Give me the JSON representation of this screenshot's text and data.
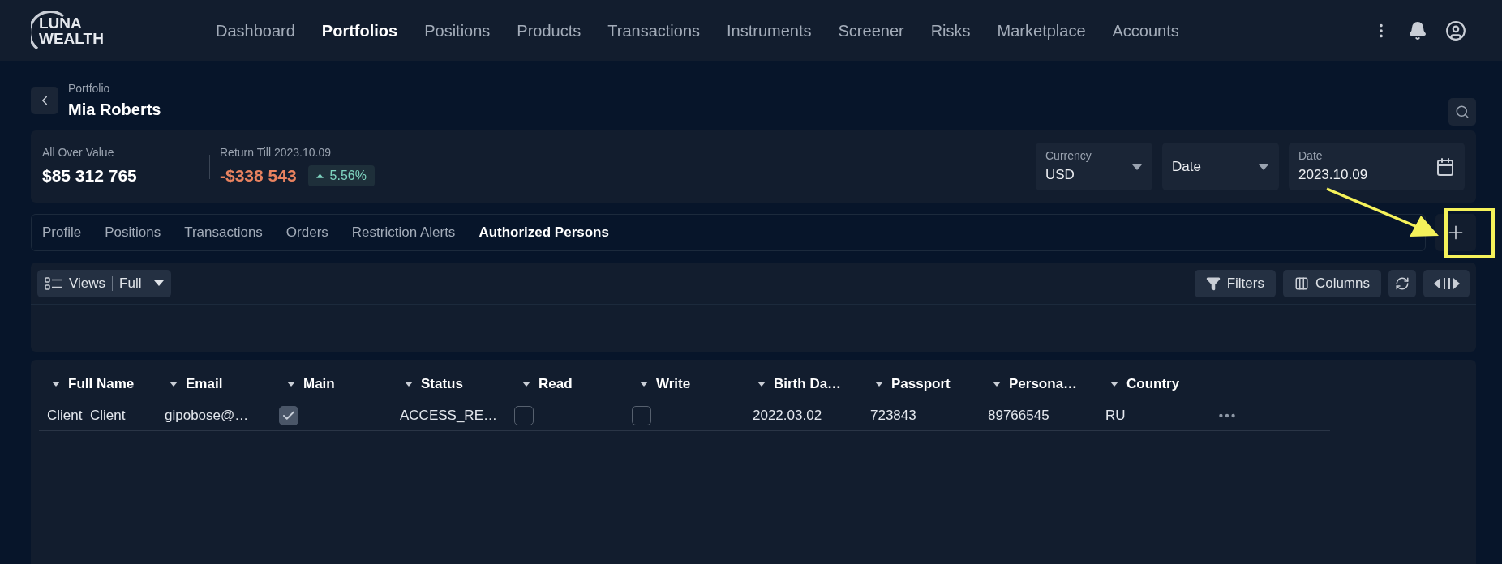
{
  "logo": {
    "line1": "LUNA",
    "line2": "WEALTH"
  },
  "nav": [
    {
      "label": "Dashboard",
      "selected": false
    },
    {
      "label": "Portfolios",
      "selected": true
    },
    {
      "label": "Positions",
      "selected": false
    },
    {
      "label": "Products",
      "selected": false
    },
    {
      "label": "Transactions",
      "selected": false
    },
    {
      "label": "Instruments",
      "selected": false
    },
    {
      "label": "Screener",
      "selected": false
    },
    {
      "label": "Risks",
      "selected": false
    },
    {
      "label": "Marketplace",
      "selected": false
    },
    {
      "label": "Accounts",
      "selected": false
    }
  ],
  "header": {
    "caption": "Portfolio",
    "title": "Mia Roberts"
  },
  "summary": {
    "value_label": "All Over Value",
    "value": "$85 312 765",
    "return_label": "Return Till 2023.10.09",
    "return_value": "-$338 543",
    "change": "5.56%"
  },
  "filters": [
    {
      "kind": "select",
      "label": "Currency",
      "value": "USD"
    },
    {
      "kind": "select",
      "value": "Date"
    },
    {
      "kind": "date",
      "label": "Date",
      "value": "2023.10.09"
    }
  ],
  "tabs": [
    {
      "label": "Profile",
      "selected": false
    },
    {
      "label": "Positions",
      "selected": false
    },
    {
      "label": "Transactions",
      "selected": false
    },
    {
      "label": "Orders",
      "selected": false
    },
    {
      "label": "Restriction Alerts",
      "selected": false
    },
    {
      "label": "Authorized Persons",
      "selected": true
    }
  ],
  "toolbar": {
    "views_label": "Views",
    "views_value": "Full",
    "filters": "Filters",
    "columns": "Columns"
  },
  "table": {
    "columns": [
      "Full Name",
      "Email",
      "Main",
      "Status",
      "Read",
      "Write",
      "Birth Da…",
      "Passport",
      "Persona…",
      "Country"
    ],
    "rows": [
      {
        "cells": [
          {
            "kind": "text",
            "text": "Client  Client"
          },
          {
            "kind": "text",
            "text": "gipobose@…"
          },
          {
            "kind": "checkbox",
            "checked": true
          },
          {
            "kind": "text",
            "text": "ACCESS_RE…"
          },
          {
            "kind": "checkbox",
            "checked": false
          },
          {
            "kind": "checkbox",
            "checked": false
          },
          {
            "kind": "text",
            "text": "2022.03.02"
          },
          {
            "kind": "text",
            "text": "723843"
          },
          {
            "kind": "text",
            "text": "89766545"
          },
          {
            "kind": "text",
            "text": "RU"
          }
        ]
      }
    ]
  }
}
